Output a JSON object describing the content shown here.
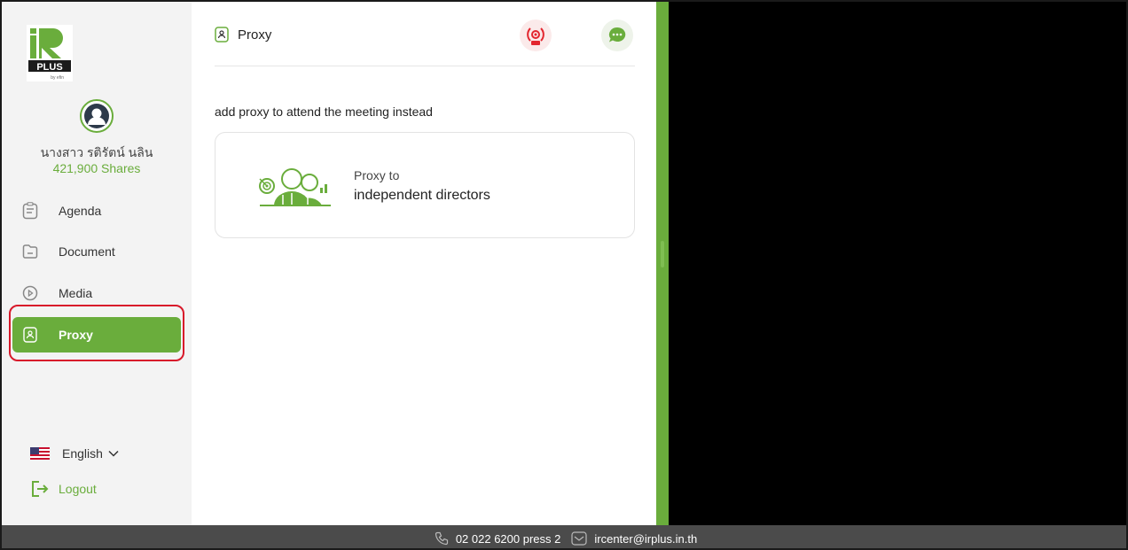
{
  "logo": {
    "brand": "iR PLUS",
    "tagline": "by efin"
  },
  "user": {
    "name": "นางสาว รติรัตน์ นลิน",
    "shares": "421,900 Shares"
  },
  "sidebar": {
    "items": [
      {
        "label": "Agenda",
        "icon": "agenda-icon"
      },
      {
        "label": "Document",
        "icon": "folder-icon"
      },
      {
        "label": "Media",
        "icon": "play-icon"
      },
      {
        "label": "Proxy",
        "icon": "proxy-icon"
      }
    ],
    "active": "Proxy"
  },
  "language": {
    "label": "English",
    "icon": "us-flag-icon"
  },
  "logout": {
    "label": "Logout"
  },
  "main": {
    "title": "Proxy",
    "subtitle": "add proxy to attend the meeting instead",
    "card": {
      "line1": "Proxy to",
      "line2": "independent directors"
    }
  },
  "footer": {
    "phone": "02 022 6200 press 2",
    "email": "ircenter@irplus.in.th"
  },
  "colors": {
    "accent": "#6aad3c",
    "highlight": "#d8192a",
    "footer_bg": "#4b4b4b"
  }
}
